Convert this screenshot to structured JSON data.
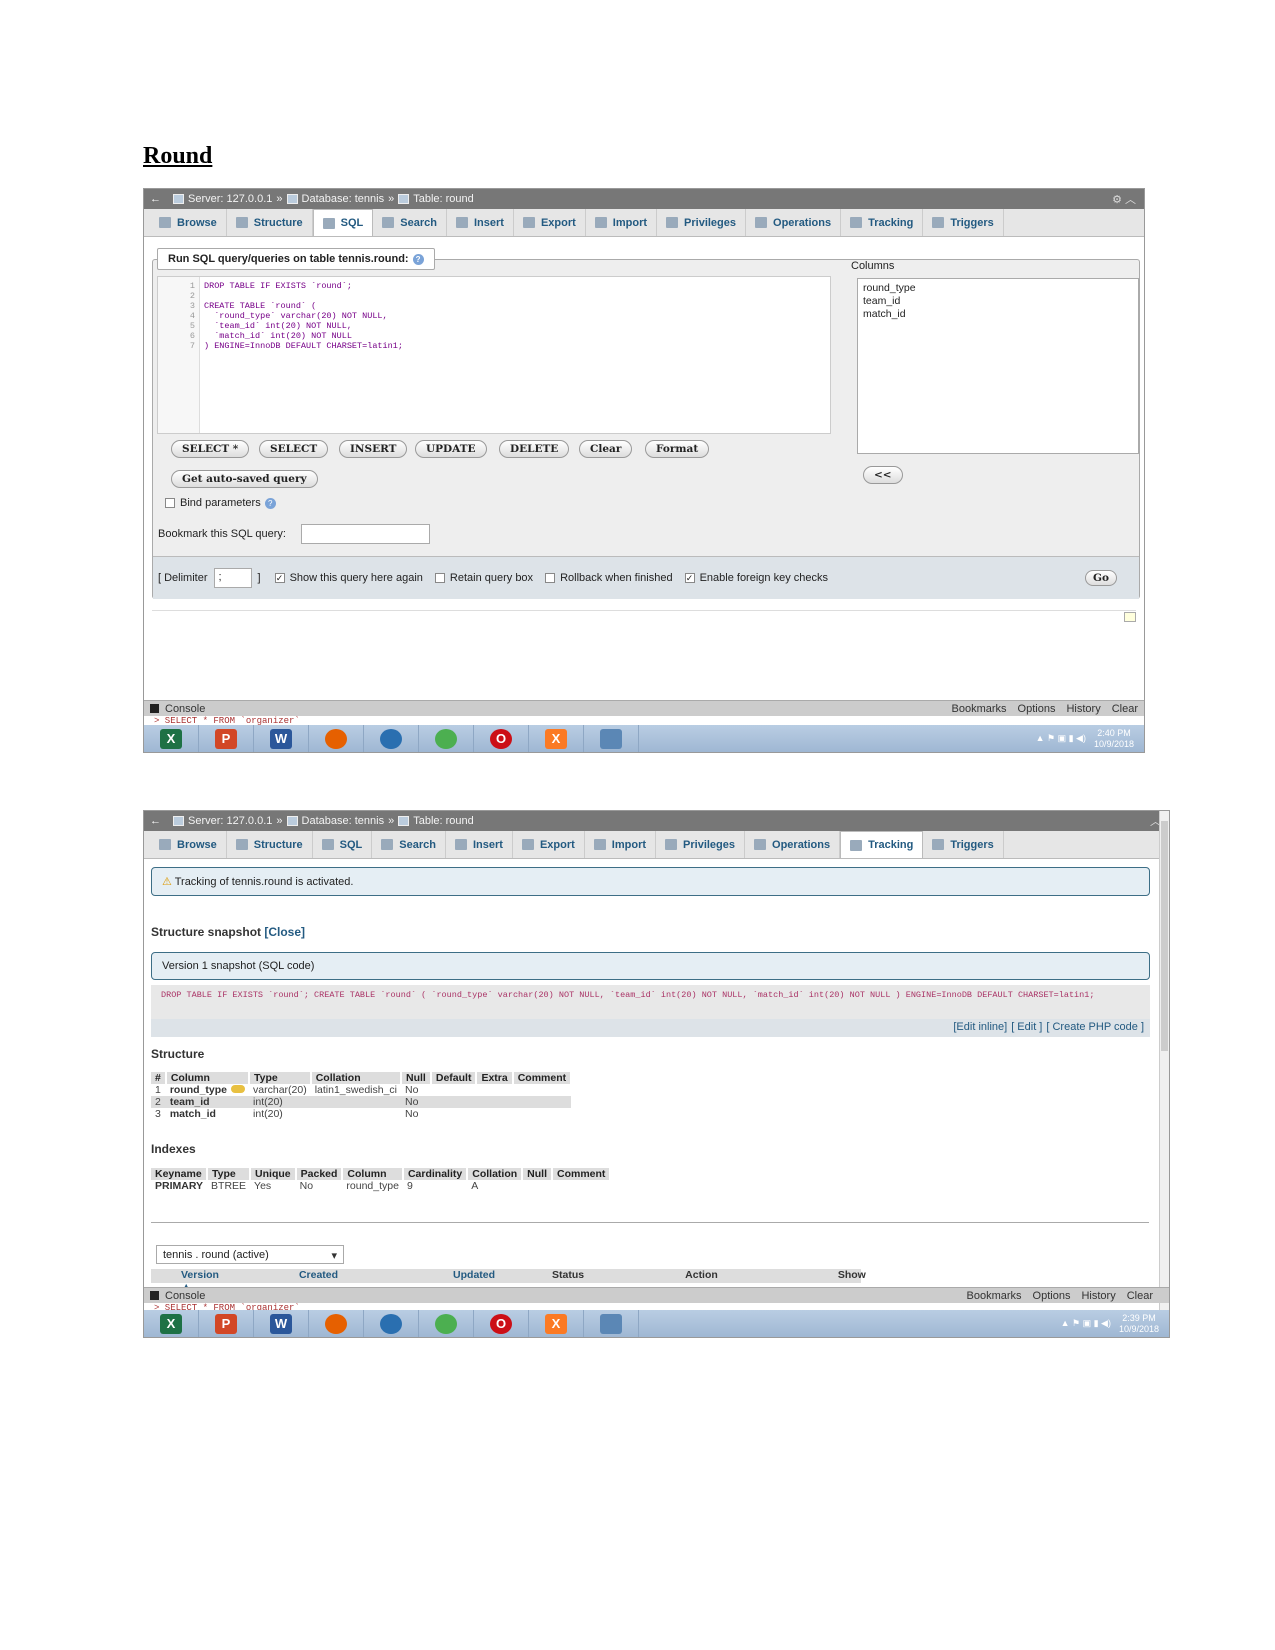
{
  "document": {
    "title": "Round"
  },
  "shot1": {
    "breadcrumb": {
      "back": "←",
      "server": "Server: 127.0.0.1",
      "database": "Database: tennis",
      "table": "Table: round",
      "sep": "»"
    },
    "tabs": [
      "Browse",
      "Structure",
      "SQL",
      "Search",
      "Insert",
      "Export",
      "Import",
      "Privileges",
      "Operations",
      "Tracking",
      "Triggers"
    ],
    "active_tab": "SQL",
    "legend": "Run SQL query/queries on table tennis.round:",
    "sql_lines": [
      "DROP TABLE IF EXISTS `round`;",
      "",
      "CREATE TABLE `round` (",
      "  `round_type` varchar(20) NOT NULL,",
      "  `team_id` int(20) NOT NULL,",
      "  `match_id` int(20) NOT NULL",
      ") ENGINE=InnoDB DEFAULT CHARSET=latin1;"
    ],
    "line_numbers": [
      "1",
      "2",
      "3",
      "4",
      "5",
      "6",
      "7"
    ],
    "buttons": [
      "SELECT *",
      "SELECT",
      "INSERT",
      "UPDATE",
      "DELETE",
      "Clear",
      "Format"
    ],
    "autosave": "Get auto-saved query",
    "bind_params": "Bind parameters",
    "bookmark_label": "Bookmark this SQL query:",
    "bookmark_value": "",
    "columns_label": "Columns",
    "columns": [
      "round_type",
      "team_id",
      "match_id"
    ],
    "insert_btn": "<<",
    "delimiter_label": "[ Delimiter",
    "delimiter_value": ";",
    "delimiter_close": "]",
    "options": [
      {
        "label": "Show this query here again",
        "checked": true
      },
      {
        "label": "Retain query box",
        "checked": false
      },
      {
        "label": "Rollback when finished",
        "checked": false
      },
      {
        "label": "Enable foreign key checks",
        "checked": true
      }
    ],
    "go": "Go",
    "console": {
      "label": "Console",
      "links": [
        "Bookmarks",
        "Options",
        "History",
        "Clear"
      ],
      "line": "> SELECT * FROM `organizer`"
    },
    "clock": {
      "time": "2:40 PM",
      "date": "10/9/2018"
    }
  },
  "shot2": {
    "breadcrumb": {
      "back": "←",
      "server": "Server: 127.0.0.1",
      "database": "Database: tennis",
      "table": "Table: round",
      "sep": "»"
    },
    "tabs": [
      "Browse",
      "Structure",
      "SQL",
      "Search",
      "Insert",
      "Export",
      "Import",
      "Privileges",
      "Operations",
      "Tracking",
      "Triggers"
    ],
    "active_tab": "Tracking",
    "notice": "Tracking of tennis.round is activated.",
    "snapshot_title": "Structure snapshot",
    "close_link": "[Close]",
    "version_box": "Version 1 snapshot (SQL code)",
    "sql": "DROP TABLE IF EXISTS `round`; CREATE TABLE `round` ( `round_type` varchar(20) NOT NULL, `team_id` int(20) NOT NULL, `match_id` int(20) NOT NULL ) ENGINE=InnoDB DEFAULT CHARSET=latin1;",
    "edit_links": [
      "[Edit inline]",
      "[ Edit ]",
      "[ Create PHP code ]"
    ],
    "structure_title": "Structure",
    "structure_headers": [
      "#",
      "Column",
      "Type",
      "Collation",
      "Null",
      "Default",
      "Extra",
      "Comment"
    ],
    "structure_rows": [
      [
        "1",
        "round_type",
        "varchar(20)",
        "latin1_swedish_ci",
        "No",
        "",
        "",
        ""
      ],
      [
        "2",
        "team_id",
        "int(20)",
        "",
        "No",
        "",
        "",
        ""
      ],
      [
        "3",
        "match_id",
        "int(20)",
        "",
        "No",
        "",
        "",
        ""
      ]
    ],
    "indexes_title": "Indexes",
    "index_headers": [
      "Keyname",
      "Type",
      "Unique",
      "Packed",
      "Column",
      "Cardinality",
      "Collation",
      "Null",
      "Comment"
    ],
    "index_rows": [
      [
        "PRIMARY",
        "BTREE",
        "Yes",
        "No",
        "round_type",
        "9",
        "A",
        "",
        ""
      ]
    ],
    "table_select": "tennis . round (active)",
    "version_headers": [
      "Version ▲",
      "Created",
      "Updated",
      "Status",
      "Action",
      "Show"
    ],
    "console": {
      "label": "Console",
      "links": [
        "Bookmarks",
        "Options",
        "History",
        "Clear"
      ],
      "line": "> SELECT * FROM `organizer`"
    },
    "clock": {
      "time": "2:39 PM",
      "date": "10/9/2018"
    }
  },
  "taskbar_apps": [
    {
      "name": "excel",
      "letter": "X",
      "color": "#1e7145"
    },
    {
      "name": "powerpoint",
      "letter": "P",
      "color": "#d24726"
    },
    {
      "name": "word",
      "letter": "W",
      "color": "#2b579a"
    },
    {
      "name": "firefox",
      "letter": "",
      "color": "#e66000"
    },
    {
      "name": "thunderbird",
      "letter": "",
      "color": "#2a6fb0"
    },
    {
      "name": "chrome",
      "letter": "",
      "color": "#4caf50"
    },
    {
      "name": "opera",
      "letter": "O",
      "color": "#cc0f16"
    },
    {
      "name": "xampp",
      "letter": "X",
      "color": "#fb7a24"
    },
    {
      "name": "window",
      "letter": "",
      "color": "#5b87b5"
    }
  ]
}
